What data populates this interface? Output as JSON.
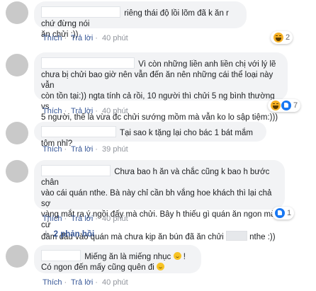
{
  "comments": [
    {
      "text_lines": [
        "riêng thái độ lồi lõm đã k ăn r chứ đừng nói",
        "ăn chửi :))"
      ],
      "actions": {
        "like": "Thích",
        "reply": "Trả lời",
        "time": "40 phút"
      },
      "reactions": {
        "types": [
          "haha-icon"
        ],
        "count": "2"
      }
    },
    {
      "text_lines": [
        "Vì còn những liền anh liền chị với lý lẽ",
        "chưa bị chửi bao giờ nên vẫn đến ăn nên những cái thể loại này vẫn",
        "còn tồn tại:)) ngta tính cả rồi, 10 người thì chửi 5 ng bình thường vs",
        "5 người, thế là vừa đc chửi sướng mồm mà vẫn ko lo sập tiệm:)))"
      ],
      "actions": {
        "like": "Thích",
        "reply": "Trả lời",
        "time": "40 phút"
      },
      "reactions": {
        "types": [
          "haha-icon",
          "like-icon"
        ],
        "count": "7"
      }
    },
    {
      "text_lines": [
        "Tại sao k tặng lại cho bác 1 bát mắm tôm nhỉ?"
      ],
      "actions": {
        "like": "Thích",
        "reply": "Trả lời",
        "time": "39 phút"
      }
    },
    {
      "text_lines": [
        "Chưa bao h ăn và chắc cũng k bao h bước chân",
        "vào cái quán nthe.  Bà này chỉ cần bh vắng hoe khách thì lại chả sợ",
        "vàng mắt ra ý ngồi đấy mà chửi. Bây h thiếu gì quán ăn ngon mà cứ",
        "đâm đầu vào quán mà chưa kịp ăn bún đã ăn chửi",
        "nthe :))"
      ],
      "actions": {
        "like": "Thích",
        "reply": "Trả lời",
        "time": "40 phút"
      },
      "reactions": {
        "types": [
          "like-icon"
        ],
        "count": "1"
      }
    },
    {
      "text_lines": [
        "Miếng ăn là miếng nhục",
        "!",
        "Có ngon đến mấy cũng quên đi"
      ],
      "actions": {
        "like": "Thích",
        "reply": "Trả lời",
        "time": "40 phút"
      }
    }
  ],
  "replies_link": "2 phản hồi"
}
